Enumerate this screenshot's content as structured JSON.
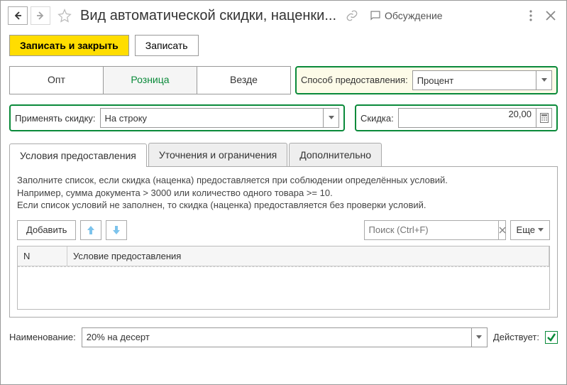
{
  "header": {
    "title": "Вид автоматической скидки, наценки...",
    "discussion": "Обсуждение"
  },
  "toolbar": {
    "save_close": "Записать и закрыть",
    "save": "Записать"
  },
  "segments": {
    "opt": "Опт",
    "retail": "Розница",
    "everywhere": "Везде"
  },
  "provision": {
    "label": "Способ предоставления:",
    "value": "Процент"
  },
  "apply": {
    "label": "Применять скидку:",
    "value": "На строку"
  },
  "discount": {
    "label": "Скидка:",
    "value": "20,00"
  },
  "tabs": {
    "conditions": "Условия предоставления",
    "refinements": "Уточнения и ограничения",
    "additional": "Дополнительно"
  },
  "hint": {
    "line1": "Заполните список, если скидка (наценка) предоставляется при соблюдении определённых условий.",
    "line2": "Например, сумма документа > 3000 или количество одного товара >= 10.",
    "line3": "Если список условий не заполнен, то скидка (наценка) предоставляется без проверки условий."
  },
  "table_toolbar": {
    "add": "Добавить",
    "search_placeholder": "Поиск (Ctrl+F)",
    "more": "Еще"
  },
  "grid": {
    "col_n": "N",
    "col_condition": "Условие предоставления"
  },
  "footer": {
    "name_label": "Наименование:",
    "name_value": "20% на десерт",
    "active_label": "Действует:"
  }
}
